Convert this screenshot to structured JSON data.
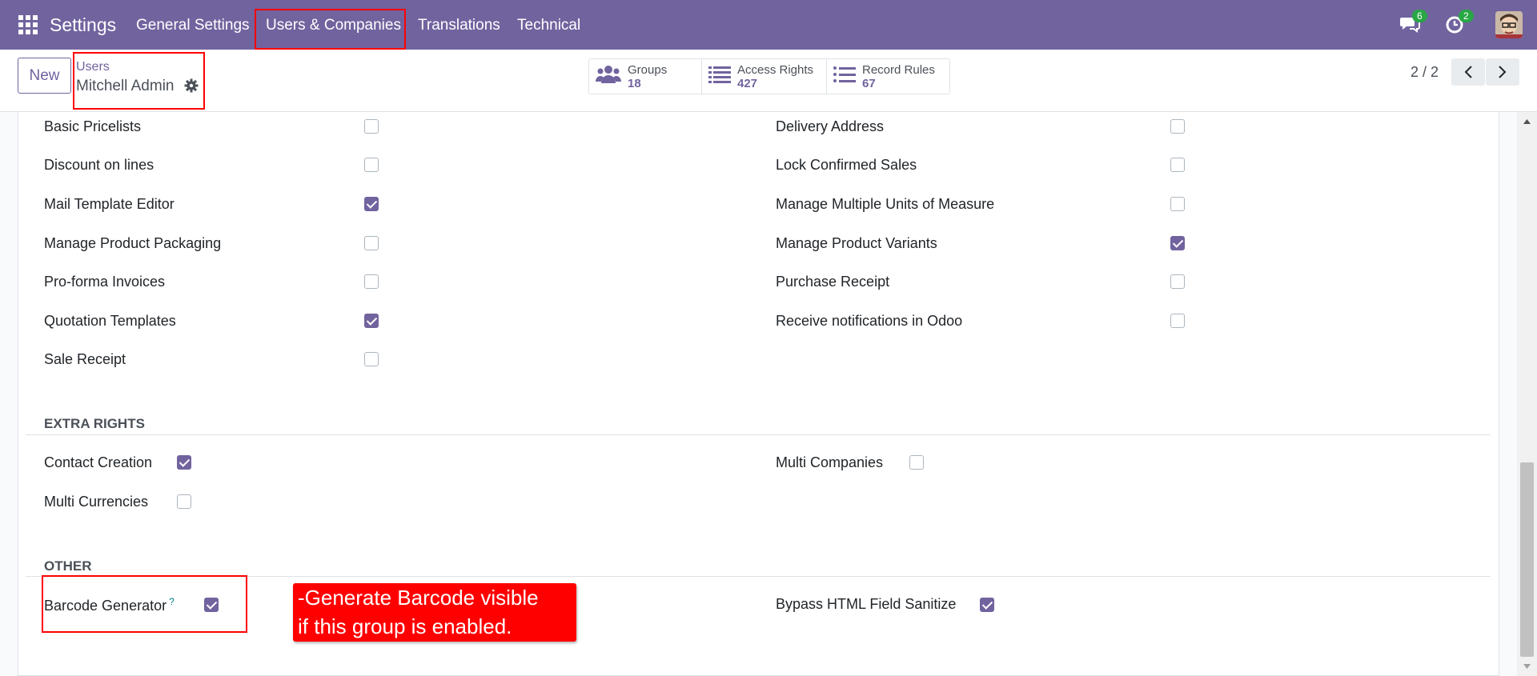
{
  "navbar": {
    "brand": "Settings",
    "menu": [
      "General Settings",
      "Users & Companies",
      "Translations",
      "Technical"
    ],
    "chat_badge": "6",
    "activity_badge": "2"
  },
  "control": {
    "new_label": "New",
    "breadcrumb_parent": "Users",
    "breadcrumb_current": "Mitchell Admin",
    "smart_buttons": [
      {
        "label": "Groups",
        "value": "18",
        "icon": "users-icon"
      },
      {
        "label": "Access Rights",
        "value": "427",
        "icon": "list-icon"
      },
      {
        "label": "Record Rules",
        "value": "67",
        "icon": "list-icon"
      }
    ],
    "pager": "2 / 2"
  },
  "technical_rights": {
    "left": [
      {
        "label": "Basic Pricelists",
        "checked": false
      },
      {
        "label": "Discount on lines",
        "checked": false
      },
      {
        "label": "Mail Template Editor",
        "checked": true
      },
      {
        "label": "Manage Product Packaging",
        "checked": false
      },
      {
        "label": "Pro-forma Invoices",
        "checked": false
      },
      {
        "label": "Quotation Templates",
        "checked": true
      },
      {
        "label": "Sale Receipt",
        "checked": false
      }
    ],
    "right": [
      {
        "label": "Delivery Address",
        "checked": false
      },
      {
        "label": "Lock Confirmed Sales",
        "checked": false
      },
      {
        "label": "Manage Multiple Units of Measure",
        "checked": false
      },
      {
        "label": "Manage Product Variants",
        "checked": true
      },
      {
        "label": "Purchase Receipt",
        "checked": false
      },
      {
        "label": "Receive notifications in Odoo",
        "checked": false
      }
    ]
  },
  "extra_rights": {
    "title": "EXTRA RIGHTS",
    "items": [
      {
        "label": "Contact Creation",
        "checked": true
      },
      {
        "label": "Multi Currencies",
        "checked": false
      },
      {
        "label": "Multi Companies",
        "checked": false
      }
    ]
  },
  "other": {
    "title": "OTHER",
    "items": [
      {
        "label": "Barcode Generator",
        "help": "?",
        "checked": true
      },
      {
        "label": "Bypass HTML Field Sanitize",
        "checked": true
      }
    ]
  },
  "annotation": {
    "line1": "-Generate Barcode visible",
    "line2": "if this group is enabled."
  }
}
